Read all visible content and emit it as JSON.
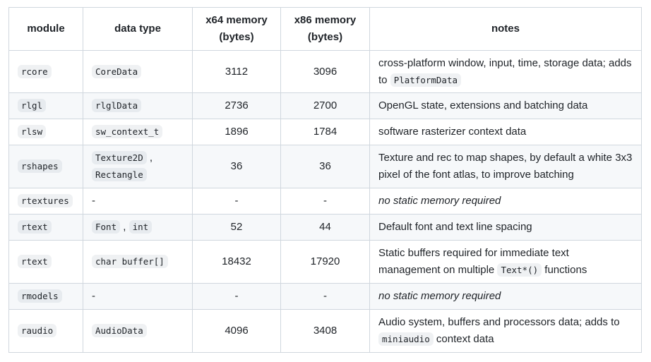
{
  "headers": {
    "module": "module",
    "data_type": "data type",
    "x64_line1": "x64 memory",
    "x64_line2": "(bytes)",
    "x86_line1": "x86 memory",
    "x86_line2": "(bytes)",
    "notes": "notes"
  },
  "rows": [
    {
      "module": "rcore",
      "types": [
        "CoreData"
      ],
      "x64": "3112",
      "x86": "3096",
      "notes_pre": "cross-platform window, input, time, storage data; adds to ",
      "notes_code": "PlatformData",
      "notes_post": ""
    },
    {
      "module": "rlgl",
      "types": [
        "rlglData"
      ],
      "x64": "2736",
      "x86": "2700",
      "notes_pre": "OpenGL state, extensions and batching data",
      "notes_code": "",
      "notes_post": ""
    },
    {
      "module": "rlsw",
      "types": [
        "sw_context_t"
      ],
      "x64": "1896",
      "x86": "1784",
      "notes_pre": "software rasterizer context data",
      "notes_code": "",
      "notes_post": ""
    },
    {
      "module": "rshapes",
      "types": [
        "Texture2D",
        "Rectangle"
      ],
      "x64": "36",
      "x86": "36",
      "notes_pre": "Texture and rec to map shapes, by default a white 3x3 pixel of the font atlas, to improve batching",
      "notes_code": "",
      "notes_post": ""
    },
    {
      "module": "rtextures",
      "types_plain": "-",
      "x64": "-",
      "x86": "-",
      "notes_italic": "no static memory required"
    },
    {
      "module": "rtext",
      "types": [
        "Font",
        "int"
      ],
      "x64": "52",
      "x86": "44",
      "notes_pre": "Default font and text line spacing",
      "notes_code": "",
      "notes_post": ""
    },
    {
      "module": "rtext",
      "types": [
        "char buffer[]"
      ],
      "x64": "18432",
      "x86": "17920",
      "notes_pre": "Static buffers required for immediate text management on multiple ",
      "notes_code": "Text*()",
      "notes_post": " functions"
    },
    {
      "module": "rmodels",
      "types_plain": "-",
      "x64": "-",
      "x86": "-",
      "notes_italic": "no static memory required"
    },
    {
      "module": "raudio",
      "types": [
        "AudioData"
      ],
      "x64": "4096",
      "x86": "3408",
      "notes_pre": "Audio system, buffers and processors data; adds to ",
      "notes_code": "miniaudio",
      "notes_post": " context data"
    }
  ]
}
